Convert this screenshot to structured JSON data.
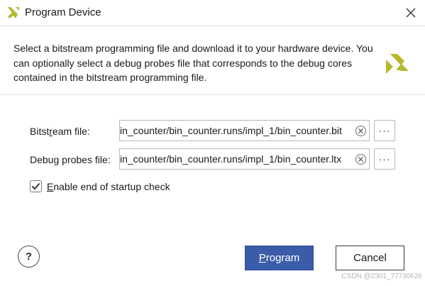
{
  "window": {
    "title": "Program Device",
    "close_icon": "close-icon",
    "app_icon": "vivado-logo-icon"
  },
  "header": {
    "description": "Select a bitstream programming file and download it to your hardware device. You can optionally select a debug probes file that corresponds to the debug cores contained in the bitstream programming file.",
    "logo_icon": "vivado-logo-icon"
  },
  "form": {
    "bitstream": {
      "label_pre": "Bitst",
      "label_mnemonic": "r",
      "label_post": "eam file:",
      "value": "in_counter/bin_counter.runs/impl_1/bin_counter.bit",
      "browse_label": "···"
    },
    "probes": {
      "label_pre": "Debu",
      "label_mnemonic": "g",
      "label_post": " probes file:",
      "value": "in_counter/bin_counter.runs/impl_1/bin_counter.ltx",
      "browse_label": "···"
    },
    "startup_check": {
      "checked": true,
      "label_mnemonic": "E",
      "label_post": "nable end of startup check"
    }
  },
  "footer": {
    "help_label": "?",
    "program_mnemonic": "P",
    "program_post": "rogram",
    "cancel_label": "Cancel"
  },
  "watermark": "CSDN @2301_77730626",
  "colors": {
    "primary_button": "#3b5ca8",
    "logo": "#b5b82a"
  }
}
